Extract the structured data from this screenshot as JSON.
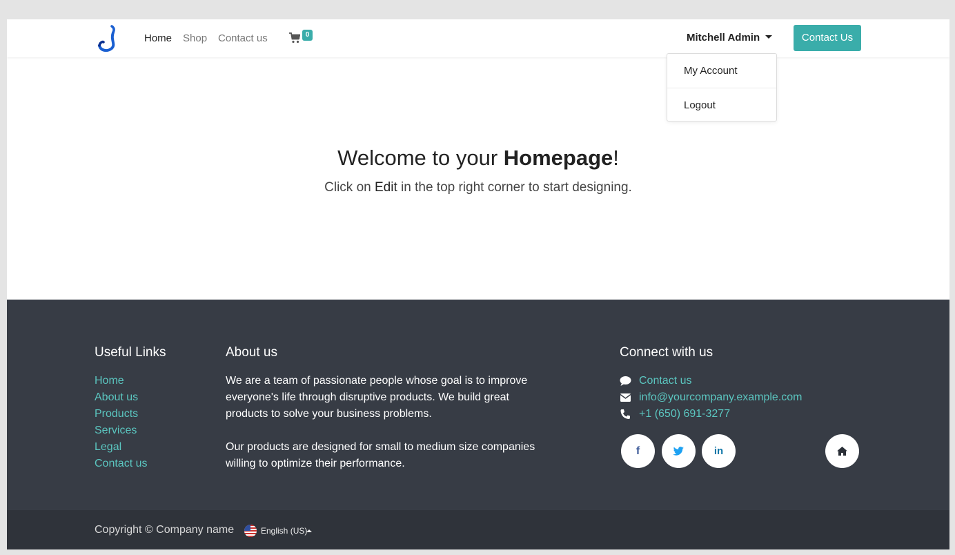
{
  "nav": {
    "links": [
      "Home",
      "Shop",
      "Contact us"
    ],
    "cart_count": "0",
    "user_name": "Mitchell Admin",
    "cta_label": "Contact Us"
  },
  "user_menu": {
    "items": [
      "My Account",
      "Logout"
    ]
  },
  "hero": {
    "title_prefix": "Welcome to your ",
    "title_bold": "Homepage",
    "title_suffix": "!",
    "sub_prefix": "Click on ",
    "sub_bold": "Edit",
    "sub_suffix": " in the top right corner to start designing."
  },
  "footer": {
    "useful_links_heading": "Useful Links",
    "useful_links": [
      "Home",
      "About us",
      "Products",
      "Services",
      "Legal",
      "Contact us"
    ],
    "about_heading": "About us",
    "about_paragraphs": [
      "We are a team of passionate people whose goal is to improve everyone's life through disruptive products. We build great products to solve your business problems.",
      "Our products are designed for small to medium size companies willing to optimize their performance."
    ],
    "connect_heading": "Connect with us",
    "contact_link": "Contact us",
    "email": "info@yourcompany.example.com",
    "phone": "+1 (650) 691-3277",
    "social_icons": [
      "facebook-icon",
      "twitter-icon",
      "linkedin-icon",
      "home-icon"
    ]
  },
  "copyright": {
    "text": "Copyright © Company name",
    "language": "English (US)"
  },
  "colors": {
    "accent": "#3aadaa",
    "footer_bg": "#373c45",
    "copyright_bg": "#2f333a",
    "link": "#5bc6c0"
  }
}
